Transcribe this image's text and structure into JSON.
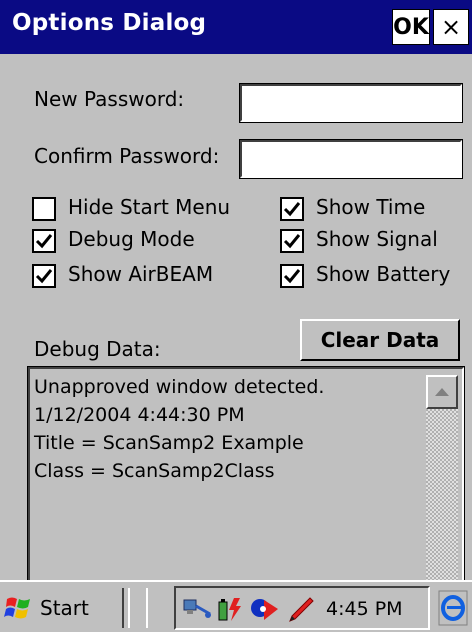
{
  "window": {
    "title": "Options Dialog",
    "ok_label": "OK",
    "close_glyph": "×"
  },
  "form": {
    "new_password_label": "New Password:",
    "new_password_value": "",
    "confirm_password_label": "Confirm Password:",
    "confirm_password_value": ""
  },
  "checkboxes": [
    {
      "label": "Hide Start Menu",
      "checked": false
    },
    {
      "label": "Show Time",
      "checked": true
    },
    {
      "label": "Debug Mode",
      "checked": true
    },
    {
      "label": "Show Signal",
      "checked": true
    },
    {
      "label": "Show AirBEAM",
      "checked": true
    },
    {
      "label": "Show Battery",
      "checked": true
    }
  ],
  "debug": {
    "label": "Debug Data:",
    "clear_button": "Clear Data",
    "lines": [
      "Unapproved window detected.",
      "1/12/2004 4:44:30 PM",
      "Title = ScanSamp2 Example",
      "Class = ScanSamp2Class"
    ]
  },
  "taskbar": {
    "start_label": "Start",
    "clock": "4:45 PM",
    "tray_icons": [
      "network-icon",
      "battery-icon",
      "airbeam-icon",
      "pen-icon"
    ]
  },
  "colors": {
    "titlebar": "#0a0a84",
    "dialog_bg": "#c0c0c0"
  }
}
